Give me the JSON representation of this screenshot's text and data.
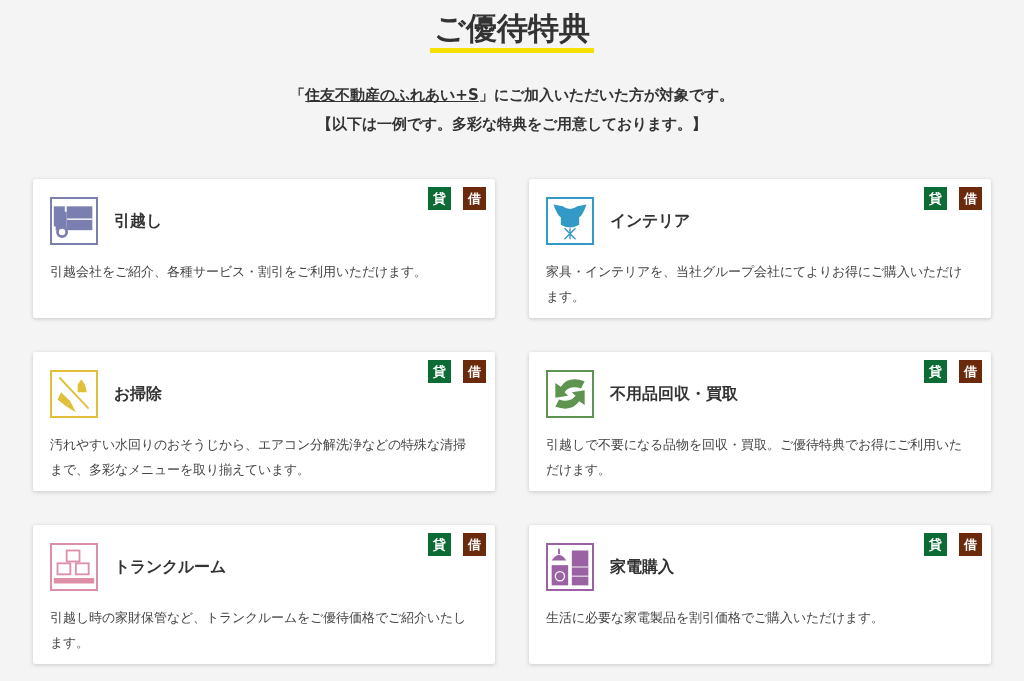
{
  "heading": "ご優待特典",
  "intro": {
    "open": "「",
    "link": "住友不動産のふれあい+S",
    "close": "」にご加入いただいた方が対象です。",
    "note": "【以下は一例です。多彩な特典をご用意しております。】"
  },
  "cards": [
    {
      "title": "引越し",
      "description": "引越会社をご紹介、各種サービス・割引をご利用いただけます。",
      "kind": "truck",
      "color": "#7b7fb0",
      "badges": [
        {
          "label": "貸",
          "color": "#0d6b36"
        },
        {
          "label": "借",
          "color": "#6b2a0b"
        }
      ]
    },
    {
      "title": "インテリア",
      "description": "家具・インテリアを、当社グループ会社にてよりお得にご購入いただけます。",
      "kind": "chair",
      "color": "#3399c6",
      "badges": [
        {
          "label": "貸",
          "color": "#0d6b36"
        },
        {
          "label": "借",
          "color": "#6b2a0b"
        }
      ]
    },
    {
      "title": "お掃除",
      "description": "汚れやすい水回りのおそうじから、エアコン分解洗浄などの特殊な清掃まで、多彩なメニューを取り揃えています。",
      "kind": "broom",
      "color": "#e0bf3a",
      "badges": [
        {
          "label": "貸",
          "color": "#0d6b36"
        },
        {
          "label": "借",
          "color": "#6b2a0b"
        }
      ]
    },
    {
      "title": "不用品回収・買取",
      "description": "引越しで不要になる品物を回収・買取。ご優待特典でお得にご利用いただけます。",
      "kind": "recycle",
      "color": "#5e9450",
      "badges": [
        {
          "label": "貸",
          "color": "#0d6b36"
        },
        {
          "label": "借",
          "color": "#6b2a0b"
        }
      ]
    },
    {
      "title": "トランクルーム",
      "description": "引越し時の家財保管など、トランクルームをご優待価格でご紹介いたします。",
      "kind": "boxes",
      "color": "#dd8fa8",
      "badges": [
        {
          "label": "貸",
          "color": "#0d6b36"
        },
        {
          "label": "借",
          "color": "#6b2a0b"
        }
      ]
    },
    {
      "title": "家電購入",
      "description": "生活に必要な家電製品を割引価格でご購入いただけます。",
      "kind": "appliances",
      "color": "#9a62a3",
      "badges": [
        {
          "label": "貸",
          "color": "#0d6b36"
        },
        {
          "label": "借",
          "color": "#6b2a0b"
        }
      ]
    }
  ]
}
